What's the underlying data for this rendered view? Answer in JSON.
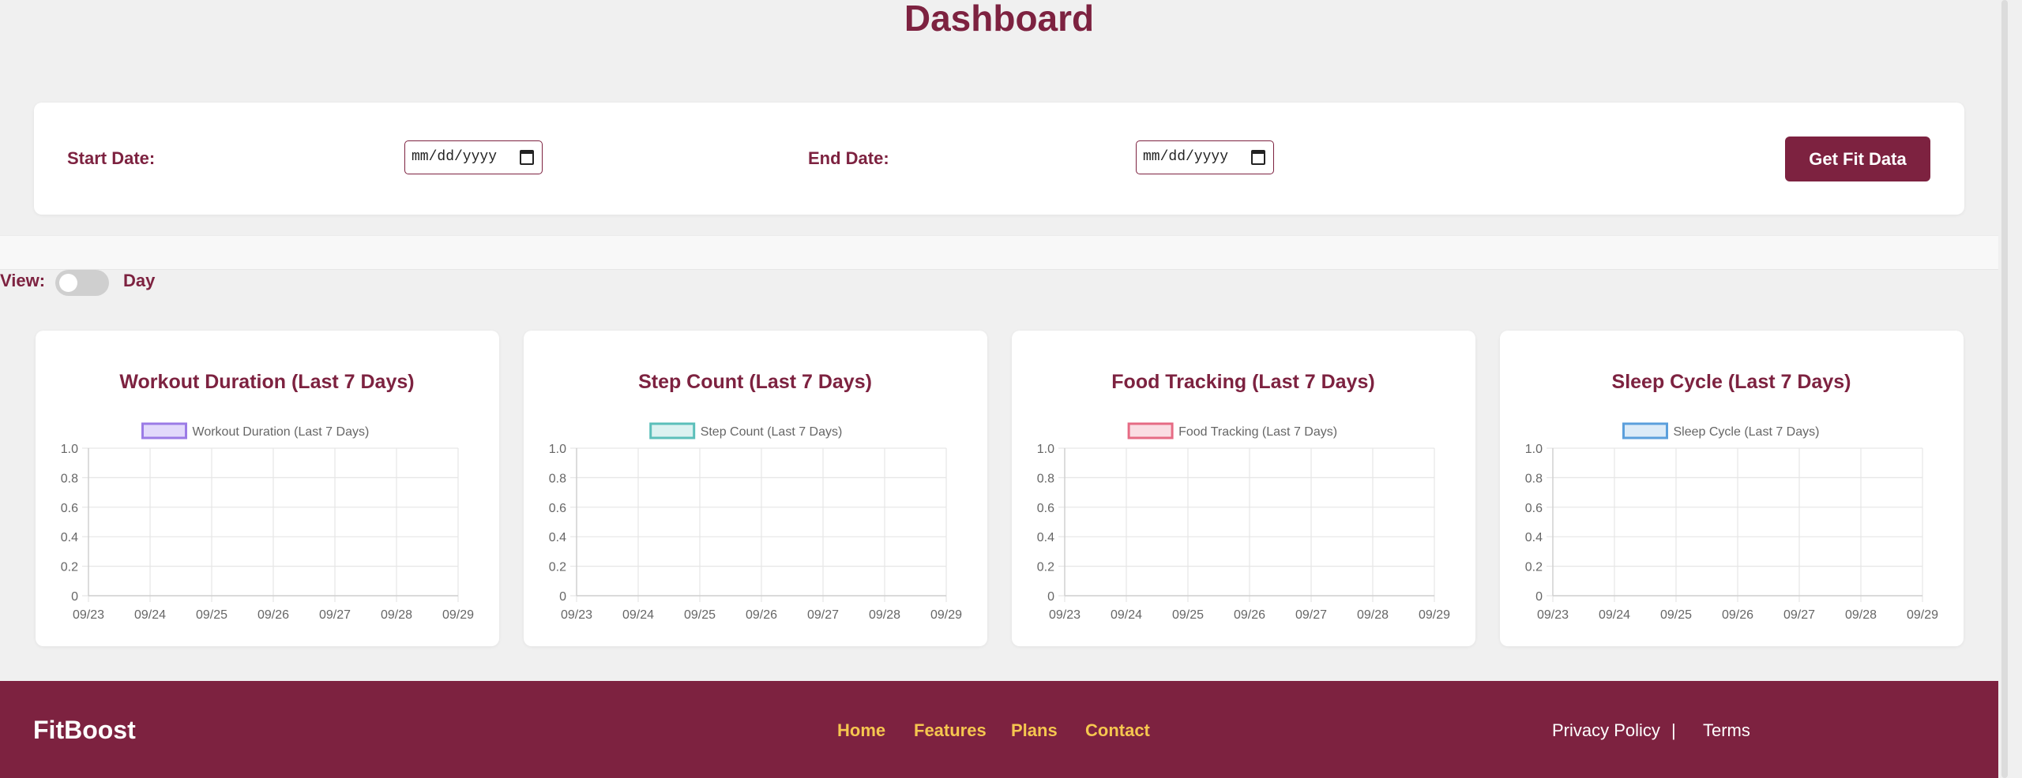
{
  "page": {
    "title": "Dashboard"
  },
  "date_range": {
    "start_label": "Start Date:",
    "start_value": "mm/dd/yyyy",
    "end_label": "End Date:",
    "end_value": "mm/dd/yyyy",
    "submit_label": "Get Fit Data"
  },
  "view_toggle": {
    "label": "View:",
    "mode": "Day",
    "on": false
  },
  "chart_data": [
    {
      "type": "line",
      "title": "Workout Duration (Last 7 Days)",
      "color": "#9b7be6",
      "fill": "#e2d9fb",
      "series": [
        {
          "name": "Workout Duration (Last 7 Days)",
          "values": []
        }
      ],
      "x": [
        "09/23",
        "09/24",
        "09/25",
        "09/26",
        "09/27",
        "09/28",
        "09/29"
      ],
      "yticks": [
        "0",
        "0.2",
        "0.4",
        "0.6",
        "0.8",
        "1.0"
      ],
      "ylim": [
        0,
        1
      ],
      "grid": true,
      "legend": "top"
    },
    {
      "type": "line",
      "title": "Step Count (Last 7 Days)",
      "color": "#5bbfba",
      "fill": "#dbf2f1",
      "series": [
        {
          "name": "Step Count (Last 7 Days)",
          "values": []
        }
      ],
      "x": [
        "09/23",
        "09/24",
        "09/25",
        "09/26",
        "09/27",
        "09/28",
        "09/29"
      ],
      "yticks": [
        "0",
        "0.2",
        "0.4",
        "0.6",
        "0.8",
        "1.0"
      ],
      "ylim": [
        0,
        1
      ],
      "grid": true,
      "legend": "top"
    },
    {
      "type": "line",
      "title": "Food Tracking (Last 7 Days)",
      "color": "#e66b84",
      "fill": "#fadde3",
      "series": [
        {
          "name": "Food Tracking (Last 7 Days)",
          "values": []
        }
      ],
      "x": [
        "09/23",
        "09/24",
        "09/25",
        "09/26",
        "09/27",
        "09/28",
        "09/29"
      ],
      "yticks": [
        "0",
        "0.2",
        "0.4",
        "0.6",
        "0.8",
        "1.0"
      ],
      "ylim": [
        0,
        1
      ],
      "grid": true,
      "legend": "top"
    },
    {
      "type": "line",
      "title": "Sleep Cycle (Last 7 Days)",
      "color": "#5b9fdc",
      "fill": "#dcebf8",
      "series": [
        {
          "name": "Sleep Cycle (Last 7 Days)",
          "values": []
        }
      ],
      "x": [
        "09/23",
        "09/24",
        "09/25",
        "09/26",
        "09/27",
        "09/28",
        "09/29"
      ],
      "yticks": [
        "0",
        "0.2",
        "0.4",
        "0.6",
        "0.8",
        "1.0"
      ],
      "ylim": [
        0,
        1
      ],
      "grid": true,
      "legend": "top"
    }
  ],
  "footer": {
    "brand": "FitBoost",
    "nav": [
      "Home",
      "Features",
      "Plans",
      "Contact"
    ],
    "privacy": "Privacy Policy",
    "separator": "|",
    "terms": "Terms"
  },
  "colors": {
    "brand": "#7d2240",
    "accent": "#f5c64f",
    "background": "#f0f0f0"
  }
}
